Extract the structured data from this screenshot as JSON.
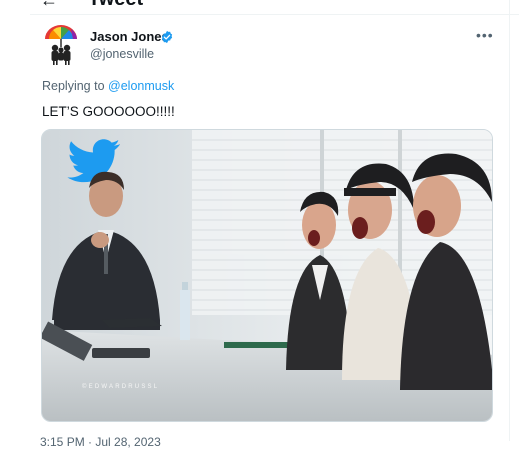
{
  "header": {
    "back_icon": "arrow-left-icon",
    "title": "Tweet"
  },
  "tweet": {
    "author": {
      "name": "Jason Jones",
      "handle": "@jonesville",
      "verified": true,
      "verified_color": "#1d9bf0"
    },
    "replying_to_prefix": "Replying to",
    "replying_to_handle": "@elonmusk",
    "text": "LET’S GOOOOOO!!!!!",
    "media_watermark": "©EDWARDRUSSL",
    "timestamp": "3:15 PM · Jul 28, 2023"
  },
  "colors": {
    "accent": "#1d9bf0",
    "secondary_text": "#536471",
    "primary_text": "#0f1419"
  },
  "icons": {
    "more": "more-dots-icon",
    "twitter": "twitter-bird-icon"
  }
}
